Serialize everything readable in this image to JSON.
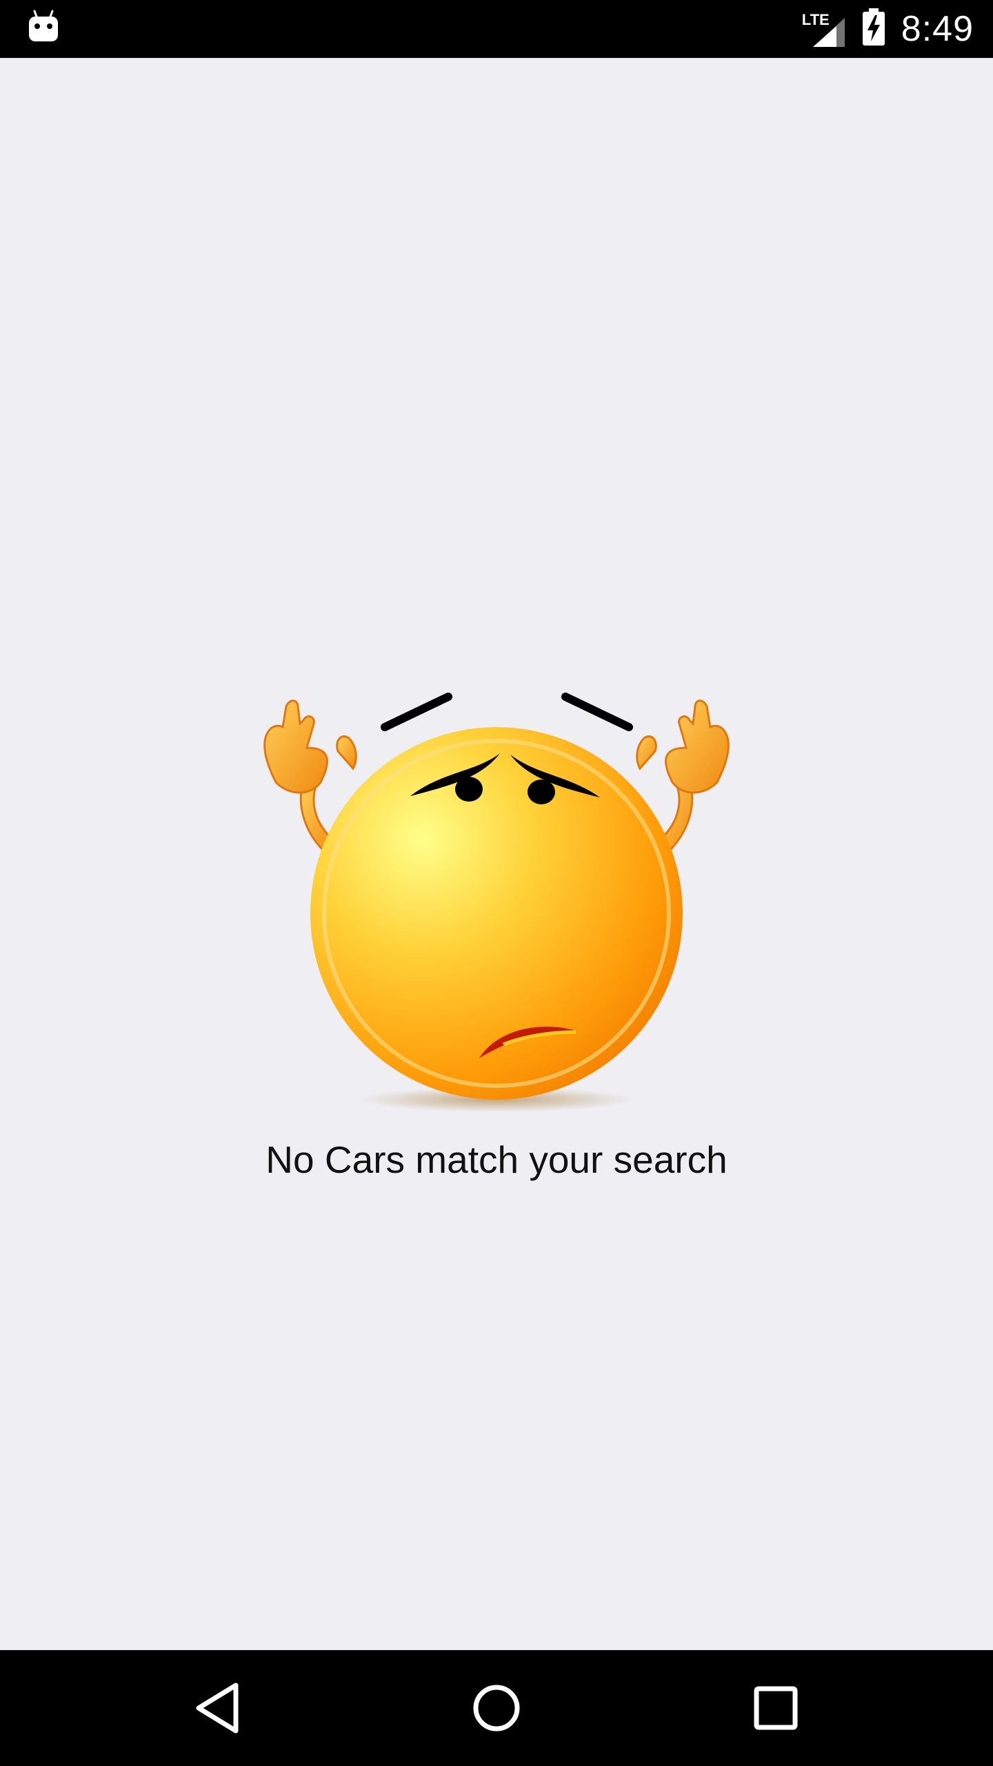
{
  "status_bar": {
    "time": "8:49",
    "network_label": "LTE",
    "icons": [
      "android-debug-icon",
      "lte-signal-icon",
      "battery-charging-icon"
    ]
  },
  "main": {
    "empty_state_message": "No Cars match your search",
    "illustration": "shrugging-sad-emoji-icon"
  },
  "nav_bar": {
    "buttons": [
      "back-icon",
      "home-icon",
      "recents-icon"
    ]
  },
  "colors": {
    "background": "#efeef3",
    "system_bars": "#000000",
    "emoji_face": "#ffb300",
    "emoji_mouth": "#c41a00"
  }
}
